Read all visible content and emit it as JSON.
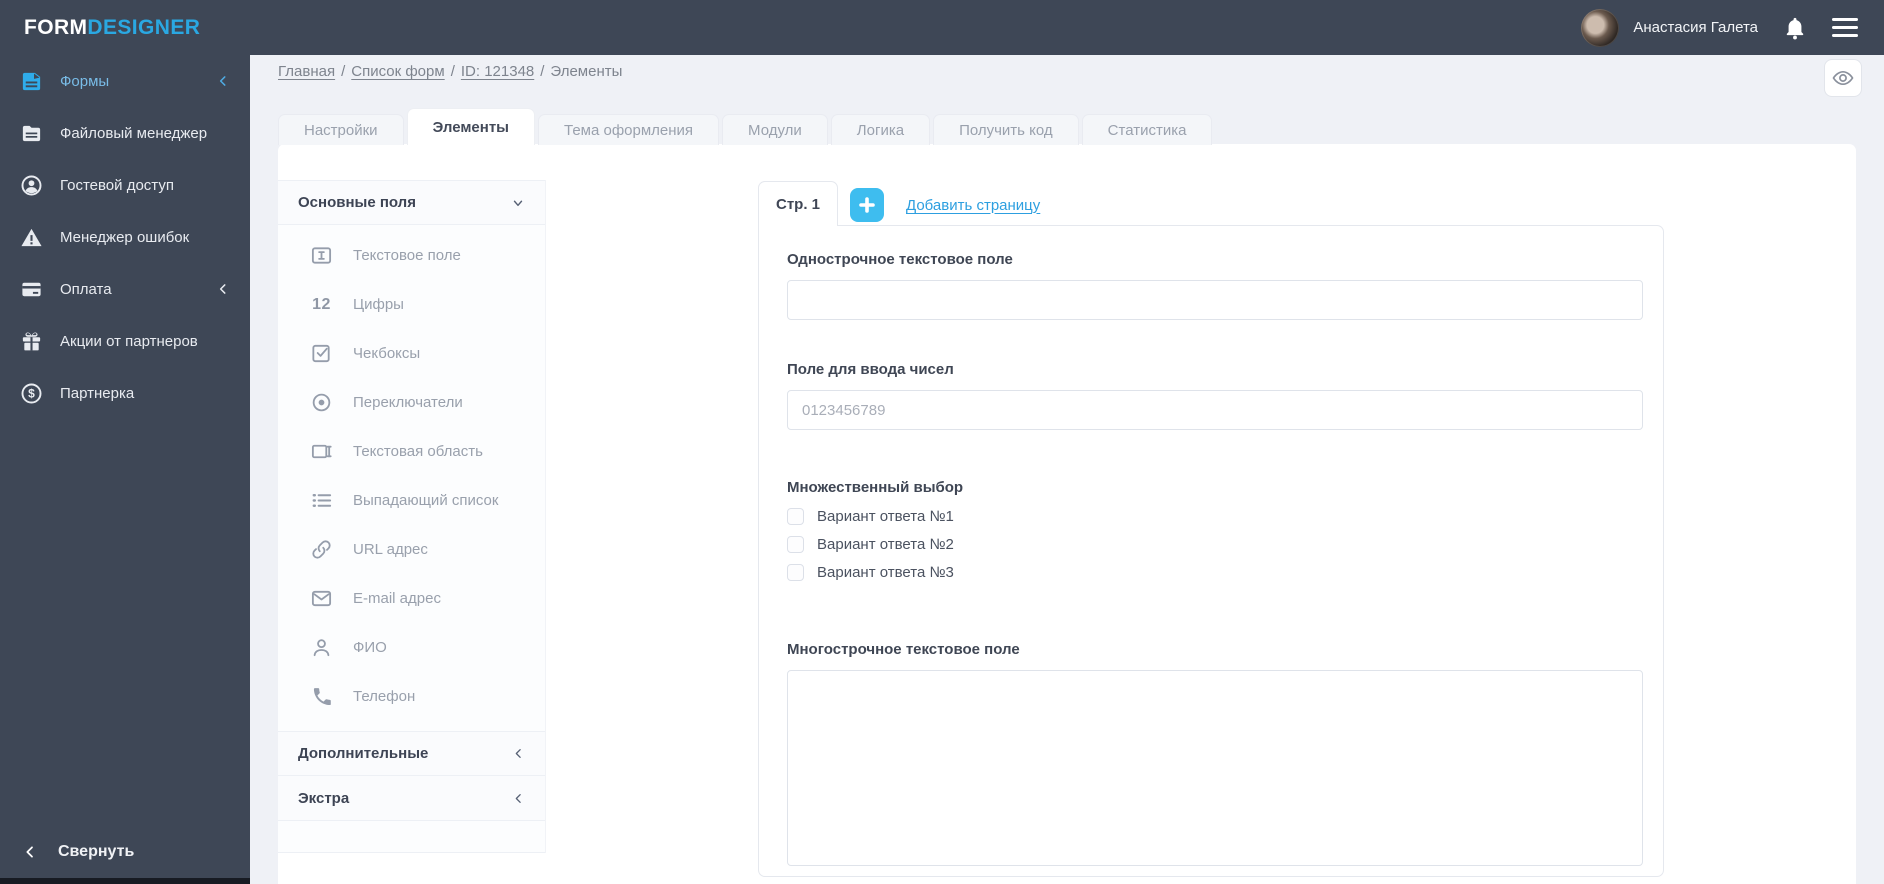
{
  "topbar": {
    "logo_part1": "FORM",
    "logo_part2": "DESIGNER",
    "user_name": "Анастасия Галета"
  },
  "sidebar": {
    "items": [
      {
        "label": "Формы",
        "icon": "forms-icon",
        "active": true,
        "has_chevron": true
      },
      {
        "label": "Файловый менеджер",
        "icon": "file-manager-icon"
      },
      {
        "label": "Гостевой доступ",
        "icon": "guest-access-icon"
      },
      {
        "label": "Менеджер ошибок",
        "icon": "error-manager-icon"
      },
      {
        "label": "Оплата",
        "icon": "payment-icon",
        "has_chevron": true
      },
      {
        "label": "Акции от партнеров",
        "icon": "gift-icon"
      },
      {
        "label": "Партнерка",
        "icon": "dollar-circle-icon"
      }
    ],
    "collapse_label": "Свернуть"
  },
  "breadcrumb": {
    "links": [
      "Главная",
      "Список форм",
      "ID: 121348"
    ],
    "current": "Элементы",
    "separator": "/"
  },
  "tabs": [
    {
      "label": "Настройки"
    },
    {
      "label": "Элементы",
      "active": true
    },
    {
      "label": "Тема оформления"
    },
    {
      "label": "Модули"
    },
    {
      "label": "Логика"
    },
    {
      "label": "Получить код"
    },
    {
      "label": "Статистика"
    }
  ],
  "elements_panel": {
    "sections": [
      {
        "title": "Основные поля",
        "expanded": true
      },
      {
        "title": "Дополнительные",
        "expanded": false
      },
      {
        "title": "Экстра",
        "expanded": false
      }
    ],
    "basic_items": [
      {
        "label": "Текстовое поле",
        "icon": "text-field-icon"
      },
      {
        "label": "Цифры",
        "icon": "numbers-icon",
        "icon_text": "12"
      },
      {
        "label": "Чекбоксы",
        "icon": "checkbox-icon"
      },
      {
        "label": "Переключатели",
        "icon": "radio-icon"
      },
      {
        "label": "Текстовая область",
        "icon": "textarea-icon"
      },
      {
        "label": "Выпадающий список",
        "icon": "dropdown-list-icon"
      },
      {
        "label": "URL адрес",
        "icon": "link-icon"
      },
      {
        "label": "E-mail адрес",
        "icon": "envelope-icon"
      },
      {
        "label": "ФИО",
        "icon": "person-icon"
      },
      {
        "label": "Телефон",
        "icon": "phone-icon"
      }
    ]
  },
  "form_preview": {
    "page_tab_label": "Стр. 1",
    "add_page_label": "Добавить страницу",
    "fields": [
      {
        "type": "text",
        "label": "Однострочное текстовое поле",
        "value": "",
        "placeholder": ""
      },
      {
        "type": "number",
        "label": "Поле для ввода чисел",
        "value": "",
        "placeholder": "0123456789"
      },
      {
        "type": "checkbox-group",
        "label": "Множественный выбор",
        "options": [
          "Вариант ответа №1",
          "Вариант ответа №2",
          "Вариант ответа №3"
        ],
        "checked": [
          false,
          false,
          false
        ]
      },
      {
        "type": "textarea",
        "label": "Многострочное текстовое поле",
        "value": ""
      }
    ]
  },
  "colors": {
    "topbar_bg": "#3E4756",
    "accent_blue": "#2AA8E2",
    "link_blue": "#2D9FE0",
    "plus_button": "#3EBDEF",
    "page_bg": "#EFF1F6",
    "card_bg": "#FFFFFF",
    "border": "#E5E8EE",
    "text_dark": "#3F4654",
    "text_gray": "#99A0AC"
  }
}
